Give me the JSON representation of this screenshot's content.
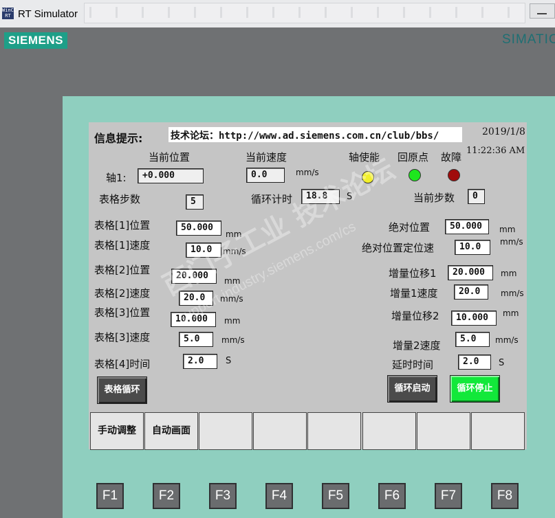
{
  "window": {
    "title": "RT Simulator",
    "icon_text": "WinCC RT"
  },
  "brand": {
    "logo": "SIEMENS",
    "model": "SIMATIC"
  },
  "header": {
    "info_label": "信息提示:",
    "info_text": "技术论坛：http://www.ad.siemens.com.cn/club/bbs/",
    "date": "2019/1/8",
    "time": "11:22:36 AM"
  },
  "status": {
    "current_position_label": "当前位置",
    "current_speed_label": "当前速度",
    "axis_enable_label": "轴使能",
    "home_label": "回原点",
    "fault_label": "故障",
    "axis_label": "轴1:",
    "axis_position": "+0.000",
    "current_speed": "0.0",
    "speed_unit": "mm/s",
    "table_steps_label": "表格步数",
    "table_steps": "5",
    "cycle_timer_label": "循环计时",
    "cycle_timer": "18.8",
    "cycle_timer_unit": "S",
    "current_step_label": "当前步数",
    "current_step": "0",
    "lamp_colors": {
      "enable": "#f2ef2a",
      "home": "#1ee61e",
      "fault": "#a00c0c"
    }
  },
  "table": {
    "t1_pos_label": "表格[1]位置",
    "t1_pos": "50.000",
    "t1_pos_unit": "mm",
    "t1_spd_label": "表格[1]速度",
    "t1_spd": "10.0",
    "t1_spd_unit": "mm/s",
    "t2_pos_label": "表格[2]位置",
    "t2_pos": "20.000",
    "t2_pos_unit": "mm",
    "t2_spd_label": "表格[2]速度",
    "t2_spd": "20.0",
    "t2_spd_unit": "mm/s",
    "t3_pos_label": "表格[3]位置",
    "t3_pos": "10.000",
    "t3_pos_unit": "mm",
    "t3_spd_label": "表格[3]速度",
    "t3_spd": "5.0",
    "t3_spd_unit": "mm/s",
    "t4_time_label": "表格[4]时间",
    "t4_time": "2.0",
    "t4_time_unit": "S"
  },
  "right": {
    "abs_pos_label": "绝对位置",
    "abs_pos": "50.000",
    "abs_pos_unit": "mm",
    "abs_spd_label": "绝对位置定位速",
    "abs_spd": "10.0",
    "abs_spd_unit": "mm/s",
    "inc1_label": "增量位移1",
    "inc1": "20.000",
    "inc1_unit": "mm",
    "inc1_spd_label": "增量1速度",
    "inc1_spd": "20.0",
    "inc1_spd_unit": "mm/s",
    "inc2_label": "增量位移2",
    "inc2": "10.000",
    "inc2_unit": "mm",
    "inc2_spd_label": "增量2速度",
    "inc2_spd": "5.0",
    "inc2_spd_unit": "mm/s",
    "delay_label": "延时时间",
    "delay": "2.0",
    "delay_unit": "S"
  },
  "buttons": {
    "table_cycle": "表格循环",
    "cycle_start": "循环启动",
    "cycle_stop": "循环停止",
    "colors": {
      "dark": "#4b4b4b",
      "stop": "#12e83a"
    }
  },
  "softkeys": [
    "手动调整",
    "自动画面",
    "",
    "",
    "",
    "",
    "",
    ""
  ],
  "function_keys": [
    "F1",
    "F2",
    "F3",
    "F4",
    "F5",
    "F6",
    "F7",
    "F8"
  ],
  "watermark": {
    "line1": "西门子工业 技术论坛",
    "line2": "support.industry.siemens.com/cs"
  }
}
